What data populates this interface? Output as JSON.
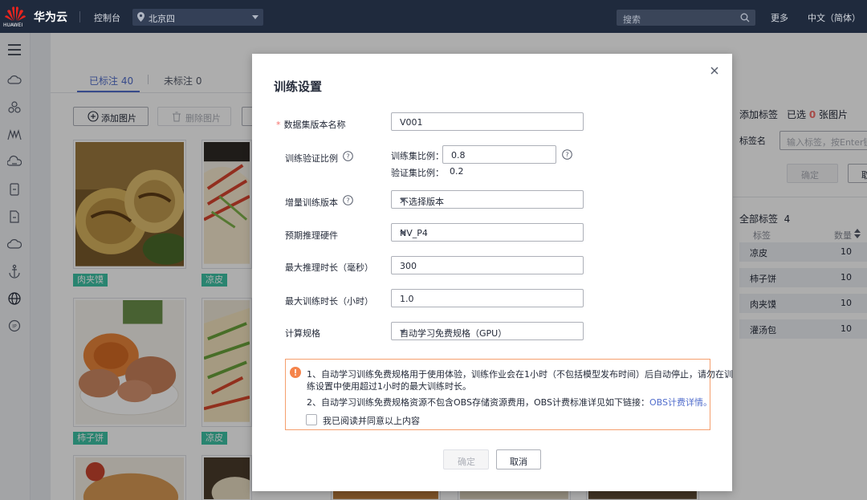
{
  "topbar": {
    "logo_text": "HUAWEI",
    "brand": "华为云",
    "console": "控制台",
    "region": "北京四",
    "search_placeholder": "搜索",
    "more": "更多",
    "language": "中文（简体）"
  },
  "page": {
    "tabs": [
      {
        "label": "已标注 40",
        "active": true
      },
      {
        "label": "未标注 0",
        "active": false
      }
    ],
    "add_image_label": "添加图片",
    "delete_image_label": "删除图片",
    "thumbnails": [
      {
        "tag": "肉夹馍"
      },
      {
        "tag": "凉皮"
      },
      {
        "tag": "柿子饼"
      },
      {
        "tag": "凉皮"
      }
    ]
  },
  "right_panel": {
    "add_tag_title": "添加标签",
    "selected_prefix": "已选",
    "selected_count": "0",
    "selected_suffix": "张图片",
    "tag_name_label": "标签名",
    "tag_input_placeholder": "输入标签，按Enter键添",
    "confirm_label": "确定",
    "cancel_label": "取",
    "all_tags_label": "全部标签",
    "all_tags_count": "4",
    "col_tag": "标签",
    "col_count": "数量",
    "rows": [
      {
        "name": "凉皮",
        "count": "10"
      },
      {
        "name": "柿子饼",
        "count": "10"
      },
      {
        "name": "肉夹馍",
        "count": "10"
      },
      {
        "name": "灌汤包",
        "count": "10"
      }
    ]
  },
  "modal": {
    "title": "训练设置",
    "version_name_label": "数据集版本名称",
    "version_name_value": "V001",
    "ratio_label": "训练验证比例",
    "train_ratio_label": "训练集比例：",
    "train_ratio_value": "0.8",
    "val_ratio_label": "验证集比例：",
    "val_ratio_value": "0.2",
    "increment_label": "增量训练版本",
    "increment_value": "不选择版本",
    "hardware_label": "预期推理硬件",
    "hardware_value": "NV_P4",
    "max_infer_label": "最大推理时长（毫秒）",
    "max_infer_value": "300",
    "max_train_label": "最大训练时长（小时）",
    "max_train_value": "1.0",
    "spec_label": "计算规格",
    "spec_value": "自动学习免费规格（GPU）",
    "notice_line1": "1、自动学习训练免费规格用于使用体验，训练作业会在1小时（不包括模型发布时间）后自动停止，请勿在训",
    "notice_line2": "练设置中使用超过1小时的最大训练时长。",
    "notice_line3": "2、自动学习训练免费规格资源不包含OBS存储资源费用，OBS计费标准详见如下链接：",
    "notice_link": "OBS计费详情。",
    "agree_label": "我已阅读并同意以上内容",
    "ok_label": "确定",
    "cancel_label": "取消"
  },
  "colors": {
    "topbar": "#1f2a3d",
    "accent": "#526ecc",
    "tag": "#3dc3a5",
    "required": "#f66f6a",
    "warning_border": "#f59f6e"
  }
}
